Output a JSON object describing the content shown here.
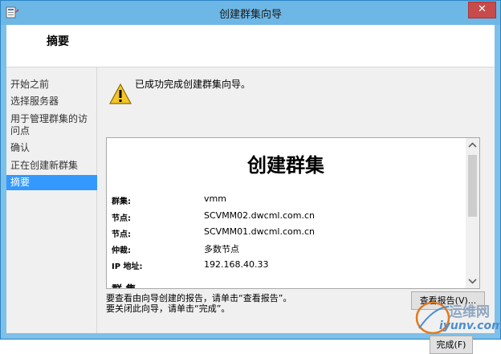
{
  "window": {
    "title": "创建群集向导",
    "close_glyph": "✕"
  },
  "header": {
    "heading": "摘要"
  },
  "nav": {
    "items": [
      {
        "label": "开始之前"
      },
      {
        "label": "选择服务器"
      },
      {
        "label": "用于管理群集的访问点"
      },
      {
        "label": "确认"
      },
      {
        "label": "正在创建新群集"
      },
      {
        "label": "摘要",
        "active": true
      }
    ]
  },
  "content": {
    "message": "已成功完成创建群集向导。",
    "report": {
      "title": "创建群集",
      "rows": [
        {
          "label": "群集:",
          "value": "vmm"
        },
        {
          "label": "节点:",
          "value": "SCVMM02.dwcml.com.cn"
        },
        {
          "label": "节点:",
          "value": "SCVMM01.dwcml.com.cn"
        },
        {
          "label": "仲裁:",
          "value": "多数节点"
        },
        {
          "label": "IP 地址:",
          "value": "192.168.40.33"
        }
      ],
      "cut_off_text": "群 集"
    },
    "hint_view": "要查看由向导创建的报告，请单击“查看报告”。",
    "hint_close": "要关闭此向导，请单击“完成”。",
    "view_report_button": "查看报告(V)...",
    "finish_button": "完成(F)"
  },
  "watermark": {
    "line1": "运维网",
    "line2": "iyunv.com"
  },
  "colors": {
    "titlebar": "#6db7e6",
    "nav_active": "#3399ff",
    "close": "#c74b4b"
  }
}
